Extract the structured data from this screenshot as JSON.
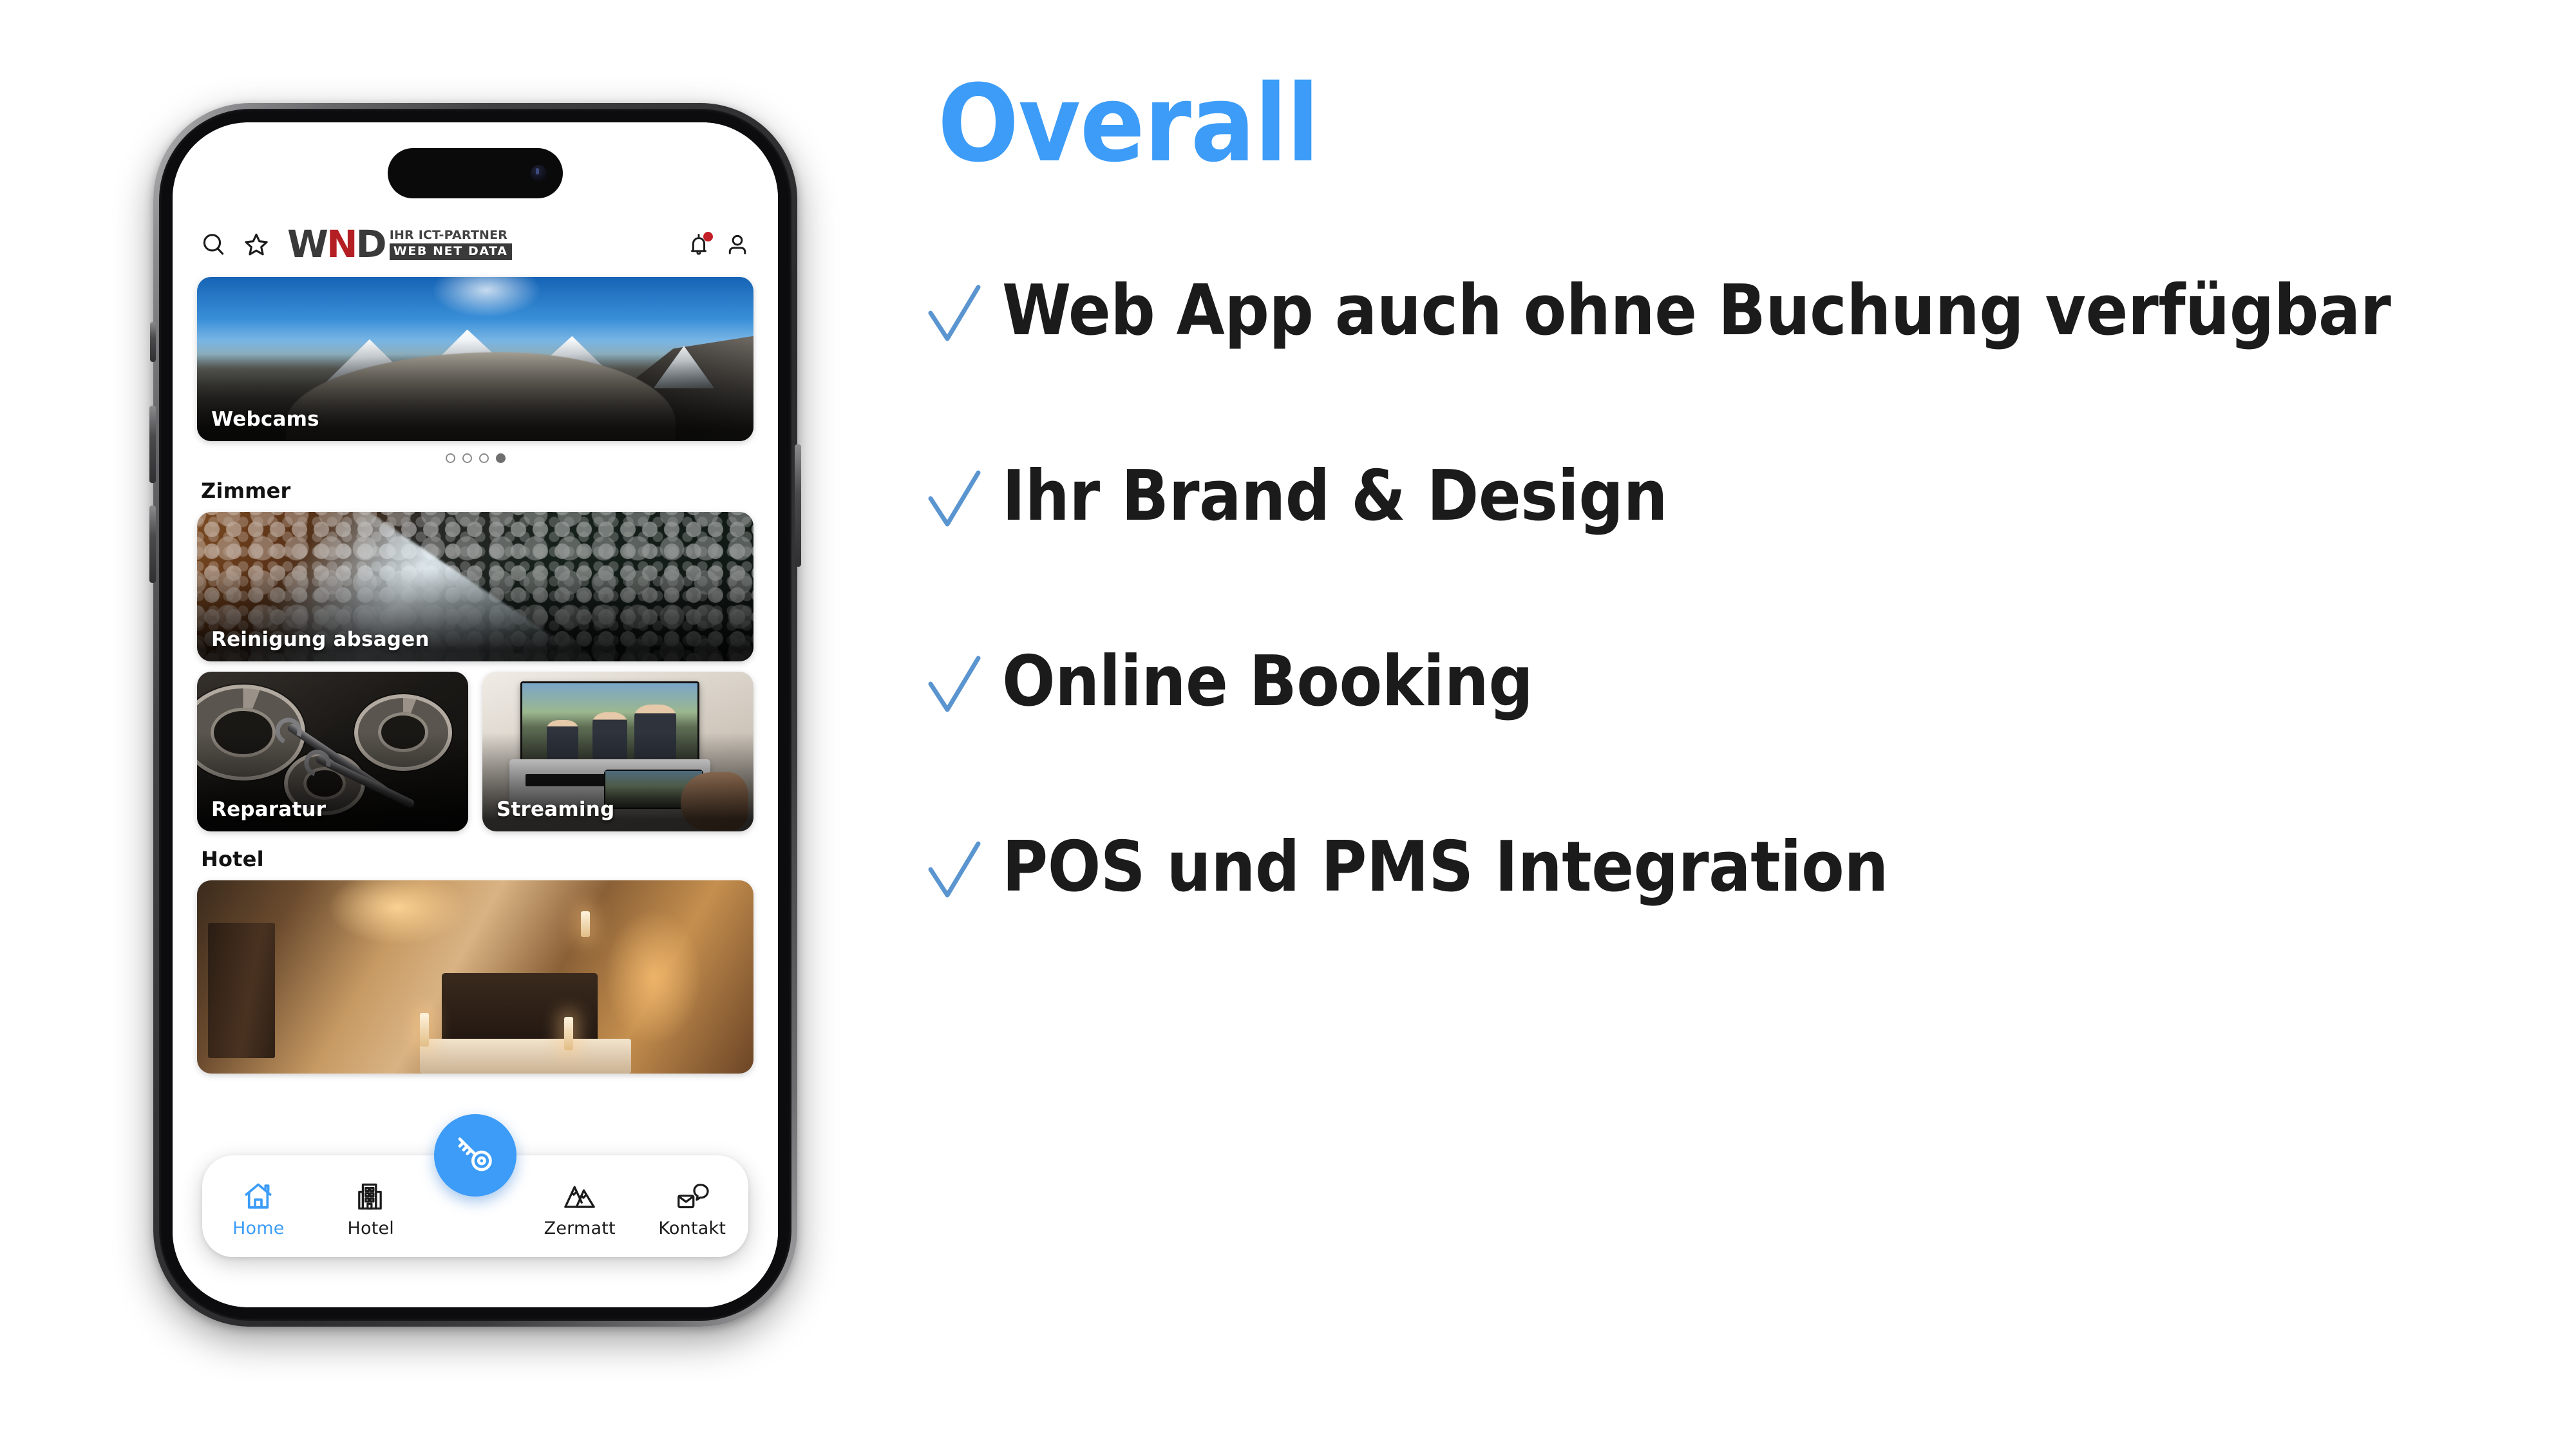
{
  "slide": {
    "title": "Overall",
    "title_color": "#3c9cf7",
    "check_color": "#5b95d0",
    "bullets": [
      {
        "id": "webapp",
        "text": "Web App auch ohne Buchung verfügbar",
        "icon": "check-icon"
      },
      {
        "id": "brand",
        "text": "Ihr Brand & Design",
        "icon": "check-icon"
      },
      {
        "id": "booking",
        "text": "Online Booking",
        "icon": "check-icon"
      },
      {
        "id": "pospms",
        "text": "POS und PMS Integration",
        "icon": "check-icon"
      }
    ]
  },
  "phone": {
    "app": {
      "header": {
        "left_icons": [
          {
            "name": "search-icon",
            "label": "Suche"
          },
          {
            "name": "star-icon",
            "label": "Favoriten"
          }
        ],
        "logo": {
          "mark_w": "W",
          "mark_n": "N",
          "mark_d": "D",
          "mark_n_color": "#b41f24",
          "mark_dark_color": "#3a3a3a",
          "tagline_top": "IHR ICT-PARTNER",
          "tagline_bottom": "WEB NET DATA"
        },
        "right_icons": [
          {
            "name": "bell-icon",
            "label": "Benachrichtigungen",
            "badge": true,
            "badge_color": "#c21f28"
          },
          {
            "name": "account-icon",
            "label": "Konto"
          }
        ]
      },
      "hero": {
        "caption": "Webcams",
        "image_desc": "gornergrat-glacier-panorama"
      },
      "carousel": {
        "total_dots": 4,
        "active_index": 3
      },
      "sections": [
        {
          "id": "zimmer",
          "title": "Zimmer",
          "cards_wide": [
            {
              "caption": "Reinigung absagen",
              "image_desc": "window-squeegee-cleaning"
            }
          ],
          "cards_pair": [
            {
              "caption": "Reparatur",
              "image_desc": "gears-and-wrench"
            },
            {
              "caption": "Streaming",
              "image_desc": "tv-casting-from-phone"
            }
          ]
        },
        {
          "id": "hotel",
          "title": "Hotel",
          "cards_wide": [
            {
              "caption": "",
              "image_desc": "warm-lit-hotel-room-corridor"
            }
          ],
          "cards_pair": []
        }
      ],
      "tabbar": {
        "items": [
          {
            "id": "home",
            "label": "Home",
            "icon": "home-icon",
            "active": true
          },
          {
            "id": "hotel",
            "label": "Hotel",
            "icon": "building-icon",
            "active": false
          },
          {
            "id": "zermatt",
            "label": "Zermatt",
            "icon": "mountain-icon",
            "active": false
          },
          {
            "id": "kontakt",
            "label": "Kontakt",
            "icon": "contact-icon",
            "active": false
          }
        ],
        "fab": {
          "id": "key",
          "icon": "key-icon",
          "color": "#3c9cf7",
          "label": "Zimmerschlüssel"
        },
        "active_color": "#3c9cf7",
        "inactive_color": "#1b1b1b"
      }
    }
  }
}
